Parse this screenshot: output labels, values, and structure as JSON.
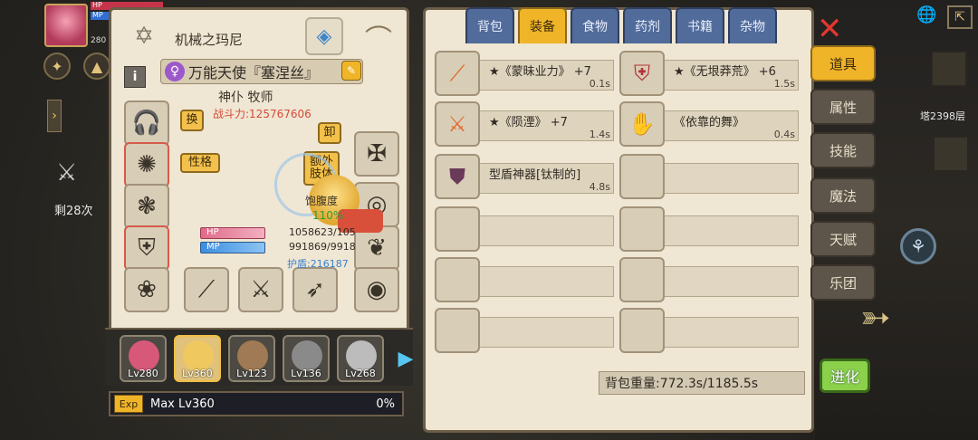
{
  "hud": {
    "hp_label": "HP",
    "mp_label": "MP",
    "side_number": "280",
    "kill_count": "剩28次"
  },
  "character": {
    "name": "机械之玛尼",
    "title": "万能天使『塞涅丝』",
    "class": "神仆 牧师",
    "power": "战斗力:125767606",
    "buttons": {
      "swap": "换",
      "unequip": "卸",
      "personality": "性格",
      "extra_limbs": "额外肢体"
    },
    "satiety_label": "饱腹度",
    "satiety_value": "110%",
    "hp_label": "HP",
    "mp_label": "MP",
    "hp_value": "1058623/105",
    "mp_value": "991869/9918",
    "shield": "护盾:216187",
    "party": [
      {
        "level": "Lv280",
        "color": "#d8587a"
      },
      {
        "level": "Lv360",
        "color": "#f0c860"
      },
      {
        "level": "Lv123",
        "color": "#a07a54"
      },
      {
        "level": "Lv136",
        "color": "#8a8a8a"
      },
      {
        "level": "Lv268",
        "color": "#bcbcbc"
      }
    ],
    "exp_badge": "Exp",
    "exp_label": "Max Lv360",
    "exp_percent": "0%"
  },
  "inventory": {
    "tabs": [
      "背包",
      "装备",
      "食物",
      "药剂",
      "书籍",
      "杂物"
    ],
    "active_tab": "装备",
    "items": [
      {
        "name": "★《蒙昧业力》 +7",
        "weight": "0.1s",
        "icon": "spear-icon"
      },
      {
        "name": "★《无垠莽荒》 +6",
        "weight": "1.5s",
        "icon": "chest-armor-icon"
      },
      {
        "name": "★《陨湮》 +7",
        "weight": "1.4s",
        "icon": "sword-icon"
      },
      {
        "name": "《依靠的舞》",
        "weight": "0.4s",
        "icon": "glove-icon"
      },
      {
        "name": "型盾神器[钛制的]",
        "weight": "4.8s",
        "icon": "shield-icon"
      }
    ],
    "weight": "背包重量:772.3s/1185.5s"
  },
  "side_menu": {
    "items": [
      "道具",
      "属性",
      "技能",
      "魔法",
      "天赋",
      "乐团"
    ],
    "active": "道具"
  },
  "map": {
    "tower_floor": "塔2398层"
  },
  "evolve_label": "进化",
  "colors": {
    "panel": "#efe6d3",
    "accent": "#f0b428",
    "tab_blue": "#516b9a",
    "power_red": "#d64a3a"
  }
}
